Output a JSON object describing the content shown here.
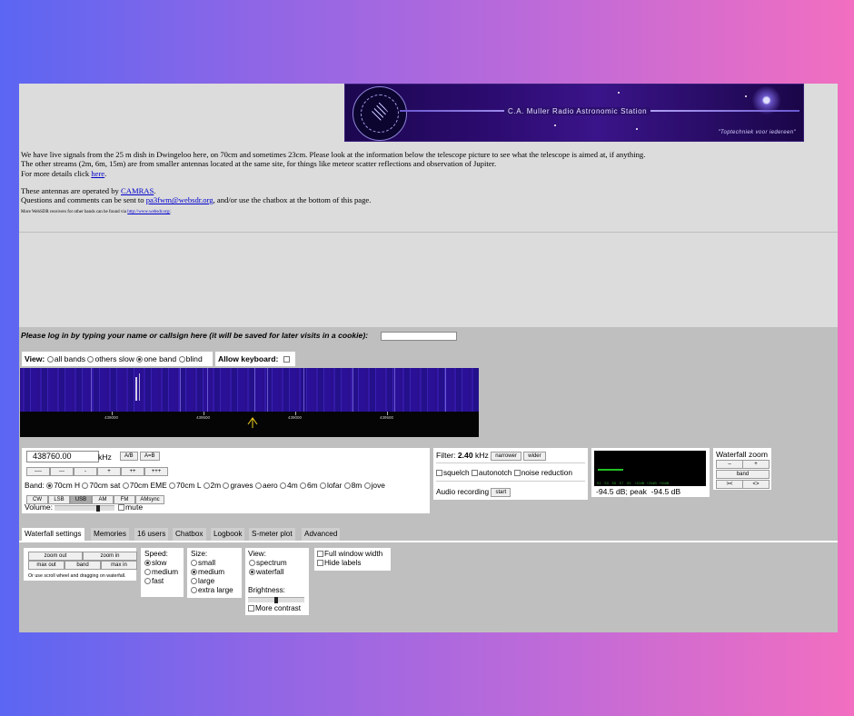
{
  "banner": {
    "station_name": "C.A. Muller Radio Astronomic Station",
    "motto": "\"Toptechniek voor iedereen\""
  },
  "intro": {
    "line1": "We have live signals from the 25 m dish in Dwingeloo here, on 70cm and sometimes 23cm. Please look at the information below the telescope picture to see what the telescope is aimed at, if anything.",
    "line2": "The other streams (2m, 6m, 15m) are from smaller antennas located at the same site, for things like meteor scatter reflections and observation of Jupiter.",
    "line3_prefix": "For more details click ",
    "line3_link": "here",
    "line3_suffix": ".",
    "line4_prefix": "These antennas are operated by ",
    "line4_link": "CAMRAS",
    "line4_suffix": ".",
    "line5_prefix": "Questions and comments can be sent to ",
    "line5_link": "pa3fwm@websdr.org",
    "line5_suffix": ", and/or use the chatbox at the bottom of this page.",
    "small_prefix": "More WebSDR receivers for other bands can be found via ",
    "small_link": "http://www.websdr.org/",
    "small_suffix": "."
  },
  "login": {
    "prompt": "Please log in by typing your name or callsign here (it will be saved for later visits in a cookie):",
    "value": ""
  },
  "view": {
    "label": "View:",
    "options": [
      "all bands",
      "others slow",
      "one band",
      "blind"
    ],
    "selected": "one band",
    "keyboard_label": "Allow keyboard:"
  },
  "waterfall": {
    "scale_labels": [
      "439000",
      "439500",
      "439000",
      "439500"
    ]
  },
  "tuning": {
    "frequency": "438760.00",
    "unit": "kHz",
    "ab": "A/B",
    "aeqb": "A=B",
    "step_buttons": [
      "----",
      "---",
      "-",
      "+",
      "++",
      "+++"
    ],
    "band_label": "Band:",
    "bands": [
      "70cm H",
      "70cm sat",
      "70cm EME",
      "70cm L",
      "2m",
      "graves",
      "aero",
      "4m",
      "6m",
      "lofar",
      "8m",
      "jove"
    ],
    "selected_band": "70cm H",
    "modes": [
      "CW",
      "LSB",
      "USB",
      "AM",
      "FM",
      "AMsync"
    ],
    "selected_mode": "USB",
    "volume_label": "Volume:",
    "volume_level": 0.75,
    "mute_label": "mute"
  },
  "filter": {
    "label": "Filter:",
    "value": "2.40",
    "unit": "kHz",
    "narrower": "narrower",
    "wider": "wider",
    "squelch": "squelch",
    "autonotch": "autonotch",
    "noise_reduction": "noise reduction",
    "audio_recording": "Audio recording",
    "start": "start"
  },
  "smeter": {
    "readout": "-94.5 dB; peak  -94.5 dB",
    "scale": [
      "S1",
      "S3",
      "S5",
      "S7",
      "S9",
      "+10dB",
      "+20dB",
      "+30dB"
    ]
  },
  "zoom": {
    "title": "Waterfall zoom",
    "minus": "–",
    "plus": "+",
    "band": "band",
    "left": "><",
    "right": "<>"
  },
  "tabs": [
    "Waterfall settings",
    "Memories",
    "16 users",
    "Chatbox",
    "Logbook",
    "S-meter plot",
    "Advanced"
  ],
  "active_tab": "Waterfall settings",
  "settings": {
    "zoom_out": "zoom out",
    "zoom_in": "zoom in",
    "max_out": "max out",
    "band": "band",
    "max_in": "max in",
    "hint": "Or use scroll wheel and dragging on waterfall.",
    "speed_label": "Speed:",
    "speeds": [
      "slow",
      "medium",
      "fast"
    ],
    "speed_selected": "slow",
    "size_label": "Size:",
    "sizes": [
      "small",
      "medium",
      "large",
      "extra large"
    ],
    "size_selected": "medium",
    "view_label": "View:",
    "views": [
      "spectrum",
      "waterfall"
    ],
    "view_selected": "waterfall",
    "brightness_label": "Brightness:",
    "brightness_level": 0.5,
    "more_contrast": "More contrast",
    "full_window": "Full window width",
    "hide_labels": "Hide labels"
  }
}
